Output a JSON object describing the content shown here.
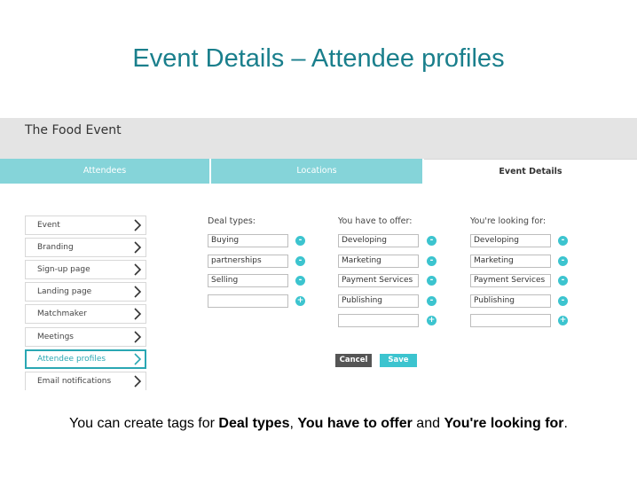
{
  "slide": {
    "title": "Event Details – Attendee profiles",
    "title_color": "#1a7f8c"
  },
  "app": {
    "title": "The Food Event"
  },
  "tabs": [
    {
      "label": "Attendees",
      "active": false
    },
    {
      "label": "Locations",
      "active": false
    },
    {
      "label": "Event Details",
      "active": true
    }
  ],
  "sidebar": {
    "items": [
      {
        "label": "Event",
        "active": false,
        "icon": "chevron-right-icon"
      },
      {
        "label": "Branding",
        "active": false,
        "icon": "chevron-right-icon"
      },
      {
        "label": "Sign-up page",
        "active": false,
        "icon": "chevron-right-icon"
      },
      {
        "label": "Landing page",
        "active": false,
        "icon": "chevron-right-icon"
      },
      {
        "label": "Matchmaker",
        "active": false,
        "icon": "chevron-right-icon"
      },
      {
        "label": "Meetings",
        "active": false,
        "icon": "chevron-right-icon"
      },
      {
        "label": "Attendee profiles",
        "active": true,
        "icon": "chevron-right-icon"
      },
      {
        "label": "Email notifications",
        "active": false,
        "icon": "chevron-right-icon"
      }
    ]
  },
  "columns": [
    {
      "label": "Deal types:",
      "tags": [
        "Buying",
        "partnerships",
        "Selling",
        ""
      ],
      "buttons": [
        "-",
        "-",
        "-",
        "+"
      ]
    },
    {
      "label": "You have to offer:",
      "tags": [
        "Developing",
        "Marketing",
        "Payment Services",
        "Publishing",
        ""
      ],
      "buttons": [
        "-",
        "-",
        "-",
        "-",
        "+"
      ]
    },
    {
      "label": "You're looking for:",
      "tags": [
        "Developing",
        "Marketing",
        "Payment Services",
        "Publishing",
        ""
      ],
      "buttons": [
        "-",
        "-",
        "-",
        "-",
        "+"
      ]
    }
  ],
  "actions": {
    "cancel_label": "Cancel",
    "save_label": "Save"
  },
  "caption": {
    "prefix": "You can create tags for ",
    "bold1": "Deal types",
    "sep1": ", ",
    "bold2": "You have to offer",
    "sep2": " and ",
    "bold3": "You're looking for",
    "suffix": "."
  },
  "colors": {
    "accent": "#3cc4cf",
    "tab_inactive": "#85d4d9",
    "header_bar": "#e4e4e4",
    "cancel": "#555555"
  }
}
